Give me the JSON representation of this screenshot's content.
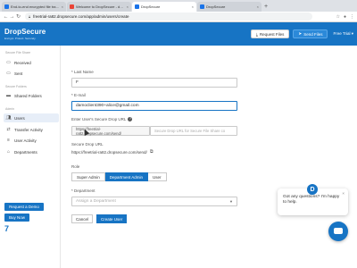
{
  "browser": {
    "tabs": [
      {
        "title": "End-to-end encrypted file transfer",
        "favicon": "ds",
        "active": false
      },
      {
        "title": "Welcome to DropSecure - damocl",
        "favicon": "gmail",
        "active": false
      },
      {
        "title": "DropSecure",
        "favicon": "ds",
        "active": true
      },
      {
        "title": "DropSecure",
        "favicon": "ds",
        "active": false
      }
    ],
    "newtab": "+",
    "url": "freetrial-ra82.dropsecure.com/app/admin/users/create"
  },
  "header": {
    "brand": "DropSecure",
    "tagline": "Encrypt. Protect. Securely.",
    "request_files": "Request Files",
    "send_files": "Send Files",
    "trial": "Free Trial"
  },
  "sidebar": {
    "section_file_share": "Secure File Share",
    "received": "Received",
    "sent": "Sent",
    "section_folders": "Secure Folders",
    "shared_folders": "Shared Folders",
    "section_admin": "Admin",
    "users": "Users",
    "transfer_activity": "Transfer Activity",
    "user_activity": "User Activity",
    "departments": "Departments",
    "request_demo": "Request a Demo",
    "buy_now": "Buy Now",
    "footer_mark": "7"
  },
  "form": {
    "last_name_label": "* Last Name",
    "last_name_value": "F",
    "email_label": "* E-mail",
    "email_value": "damoclient390+alice@gmail.com",
    "secure_url_label": "Enter User's Secure Drop URL",
    "secure_url_prefix": "https://freetrial-ra82.dropsecure.com/send/",
    "secure_url_placeholder": "Secure Drop URL for Secure File Share co",
    "secure_drop_label": "Secure Drop URL",
    "secure_drop_value": "https://freetrial-ra82.dropsecure.com/send/",
    "role_label": "Role",
    "roles": [
      "Super Admin",
      "Department Admin",
      "User"
    ],
    "department_label": "* Department",
    "department_placeholder": "Assign a Department",
    "cancel": "Cancel",
    "create": "Create User"
  },
  "chat": {
    "message": "Got any questions? I'm happy to help.",
    "logo": "D",
    "close": "×"
  },
  "colors": {
    "brand": "#1774c4",
    "active_bg": "#e7eef8"
  }
}
